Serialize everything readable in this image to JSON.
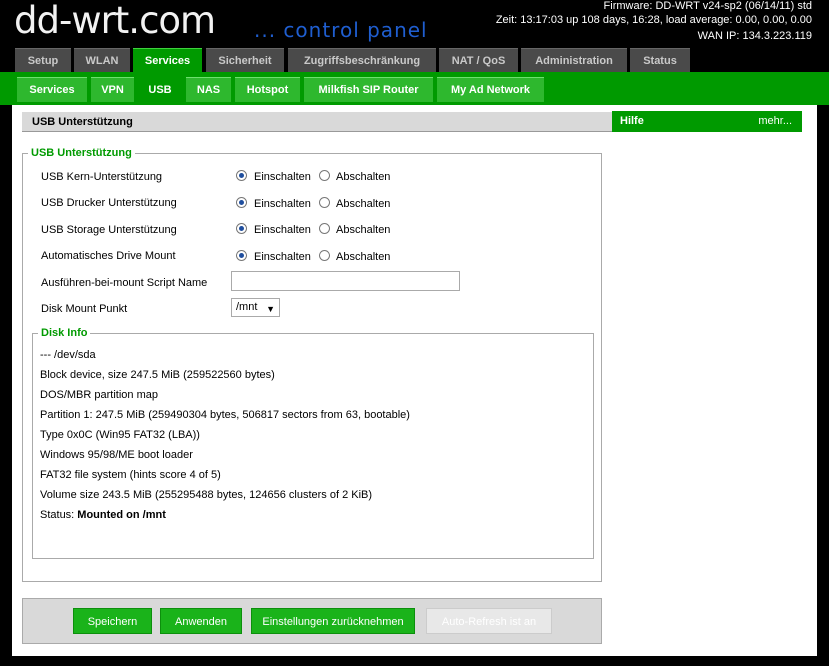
{
  "header": {
    "logo": "dd-wrt.com",
    "logo_sub": "... control panel",
    "firmware": "Firmware: DD-WRT v24-sp2 (06/14/11) std",
    "time": "Zeit: 13:17:03 up 108 days, 16:28, load average: 0.00, 0.00, 0.00",
    "wan_ip": "WAN IP: 134.3.223.119"
  },
  "main_tabs": [
    "Setup",
    "WLAN",
    "Services",
    "Sicherheit",
    "Zugriffsbeschränkung",
    "NAT / QoS",
    "Administration",
    "Status"
  ],
  "sub_tabs": [
    "Services",
    "VPN",
    "USB",
    "NAS",
    "Hotspot",
    "Milkfish SIP Router",
    "My Ad Network"
  ],
  "section_title": "USB Unterstützung",
  "fieldset_legend": "USB Unterstützung",
  "options": [
    {
      "label": "USB Kern-Unterstützung",
      "on": "Einschalten",
      "off": "Abschalten",
      "selected": "on"
    },
    {
      "label": "USB Drucker Unterstützung",
      "on": "Einschalten",
      "off": "Abschalten",
      "selected": "on"
    },
    {
      "label": "USB Storage Unterstützung",
      "on": "Einschalten",
      "off": "Abschalten",
      "selected": "on"
    },
    {
      "label": "Automatisches Drive Mount",
      "on": "Einschalten",
      "off": "Abschalten",
      "selected": "on"
    }
  ],
  "script_name": {
    "label": "Ausführen-bei-mount Script Name",
    "value": ""
  },
  "mount_point": {
    "label": "Disk Mount Punkt",
    "value": "/mnt"
  },
  "disk_info": {
    "legend": "Disk Info",
    "lines": [
      "--- /dev/sda",
      "Block device, size 247.5 MiB (259522560 bytes)",
      "DOS/MBR partition map",
      "Partition 1: 247.5 MiB (259490304 bytes, 506817 sectors from 63, bootable)",
      "Type 0x0C (Win95 FAT32 (LBA))",
      "Windows 95/98/ME boot loader",
      "FAT32 file system (hints score 4 of 5)",
      "Volume size 243.5 MiB (255295488 bytes, 124656 clusters of 2 KiB)"
    ],
    "status_label": "Status: ",
    "status_value": "Mounted on /mnt"
  },
  "buttons": {
    "save": "Speichern",
    "apply": "Anwenden",
    "reset": "Einstellungen zurücknehmen",
    "autorefresh": "Auto-Refresh ist an"
  },
  "help": {
    "title": "Hilfe",
    "more": "mehr..."
  },
  "colors": {
    "green": "#009a00",
    "tab_inactive": "#4a4a4a",
    "logo_sub": "#1f5ed0"
  }
}
